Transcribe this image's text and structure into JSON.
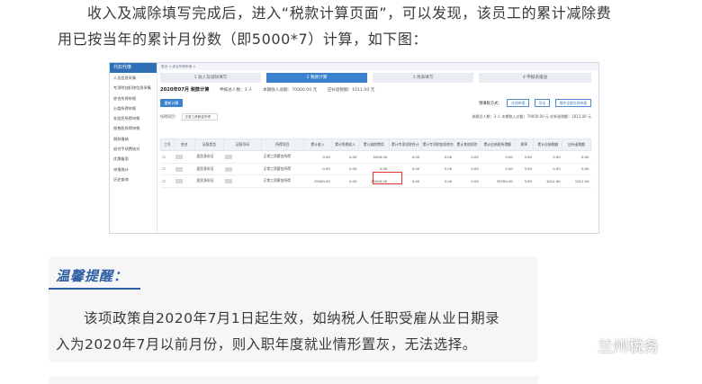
{
  "intro": {
    "line1": "收入及减除填写完成后，进入“税款计算页面”，可以发现，该员工的累计减除费",
    "line2": "用已按当年的累计月份数（即5000*7）计算，如下图："
  },
  "screenshot": {
    "nav_title": "代扣代缴",
    "nav_items": [
      "人员信息采集",
      "专项附加扣除信息采集",
      "综合所得申报",
      "分类所得申报",
      "非居民所得申报",
      "限售股所得申报",
      "税款缴纳",
      "退付手续费核对",
      "优惠备案",
      "申报统计",
      "历史查询"
    ],
    "breadcrumb": "首页 × 综合所得申报 ×",
    "steps": [
      "1 收入及减除填写",
      "2 税款计算",
      "3 附表填写",
      "4 申报表报送"
    ],
    "active_step": 2,
    "header": {
      "title": "2020年07月 税款计算",
      "count": "申报总人数：3 人",
      "income": "本期收入总额：70000.00 元",
      "tax": "应补退税额：1011.00 元"
    },
    "toolbar": {
      "button": "重新计算",
      "mode_label": "预填税方式：",
      "btn1": "在线申报",
      "btn2": "导出",
      "btn3": "操作全部在线申报"
    },
    "subbar": {
      "label": "所得项目：",
      "value": "正常工资薪金所得",
      "summary": "纳税总人数：3 人  本期收入总额：70000.00 元  应补退税额：1011.00 元"
    },
    "columns": [
      "工号",
      "姓名",
      "证照类型",
      "证照号码",
      "所得项目",
      "累计收入",
      "累计免税收入",
      "累计减除费用",
      "累计专项扣除合计",
      "累计专项附加扣除合计",
      "累计其他扣除",
      "累计应纳税所得额",
      "税率",
      "累计应纳税额",
      "应补退税额"
    ],
    "rows": [
      [
        "",
        "",
        "居民身份证",
        "",
        "正常工资薪金所得",
        "0.00",
        "0.00",
        "5000.00",
        "0.00",
        "0.00",
        "0.00",
        "0.00",
        "3.00",
        "0.00",
        "0.00"
      ],
      [
        "",
        "",
        "居民身份证",
        "",
        "正常工资薪金所得",
        "0.00",
        "0.00",
        "0.00",
        "0.00",
        "0.00",
        "0.00",
        "0.00",
        "3.00",
        "0.00",
        "0.00"
      ],
      [
        "",
        "",
        "居民身份证",
        "",
        "正常工资薪金所得",
        "70000.00",
        "0.00",
        "35000.00",
        "0.00",
        "0.00",
        "0.00",
        "33700.00",
        "3.00",
        "1011.00",
        "1011.00"
      ]
    ]
  },
  "tip": {
    "title": "温馨提醒：",
    "line1": "该项政策自2020年7月1日起生效，如纳税人任职受雇从业日期录",
    "line2": "入为2020年7月以前月份，则入职年度就业情形置灰，无法选择。"
  },
  "watermark": {
    "text": "兰州税务",
    "icon": "wechat-icon"
  }
}
